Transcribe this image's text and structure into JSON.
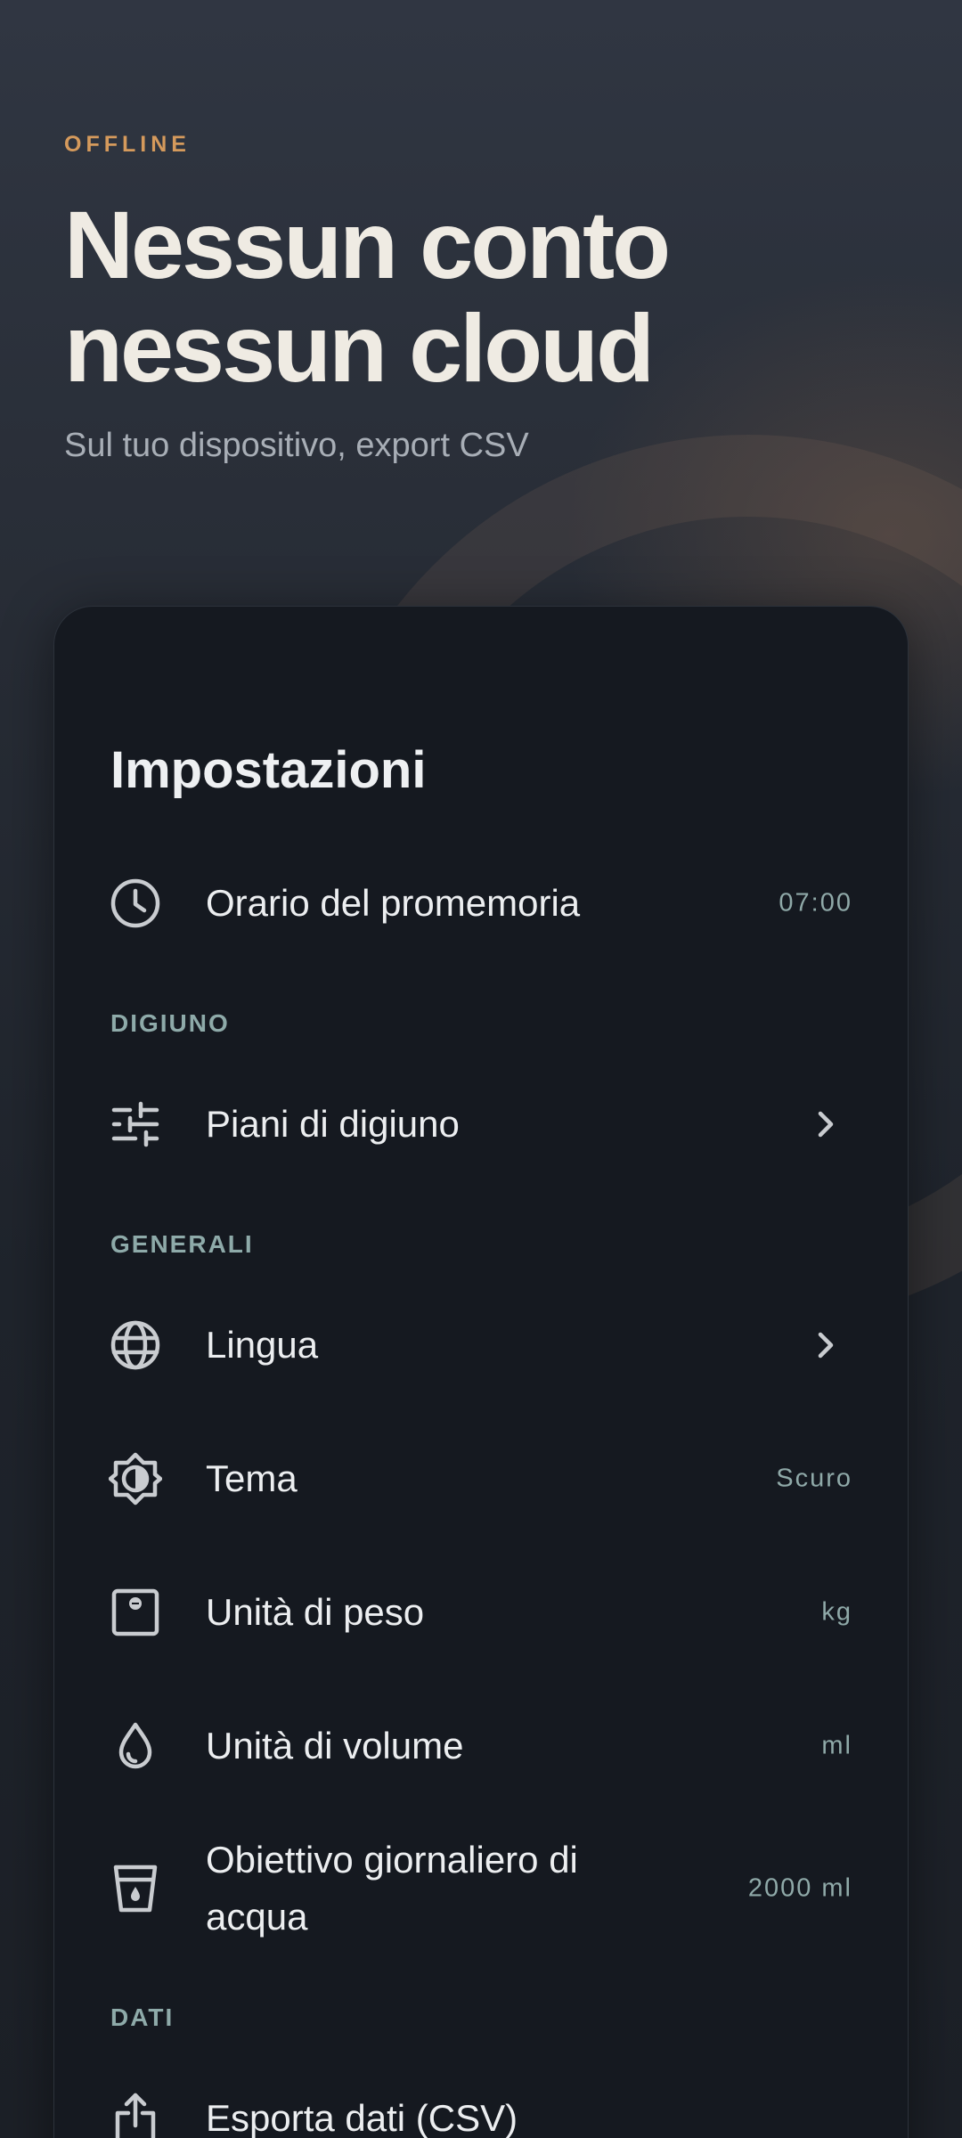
{
  "hero": {
    "eyebrow": "OFFLINE",
    "title_line1": "Nessun conto",
    "title_line2": "nessun cloud",
    "subtitle": "Sul tuo dispositivo, export CSV"
  },
  "settings": {
    "title": "Impostazioni",
    "reminder": {
      "label": "Orario del promemoria",
      "value": "07:00",
      "icon": "clock-icon"
    },
    "sections": {
      "fasting": "DIGIUNO",
      "general": "GENERALI",
      "data": "DATI"
    },
    "fasting_plans": {
      "label": "Piani di digiuno",
      "icon": "sliders-icon"
    },
    "language": {
      "label": "Lingua",
      "icon": "globe-icon"
    },
    "theme": {
      "label": "Tema",
      "value": "Scuro",
      "icon": "brightness-icon"
    },
    "weight_unit": {
      "label": "Unità di peso",
      "value": "kg",
      "icon": "scale-icon"
    },
    "volume_unit": {
      "label": "Unità di volume",
      "value": "ml",
      "icon": "water-drop-icon"
    },
    "water_goal": {
      "label": "Obiettivo giornaliero di acqua",
      "value": "2000 ml",
      "icon": "water-glass-icon"
    },
    "export": {
      "label": "Esporta dati (CSV)",
      "icon": "share-icon"
    }
  },
  "colors": {
    "accent": "#d59a5c",
    "value_text": "#8fa9a8",
    "card_bg": "#151920"
  }
}
